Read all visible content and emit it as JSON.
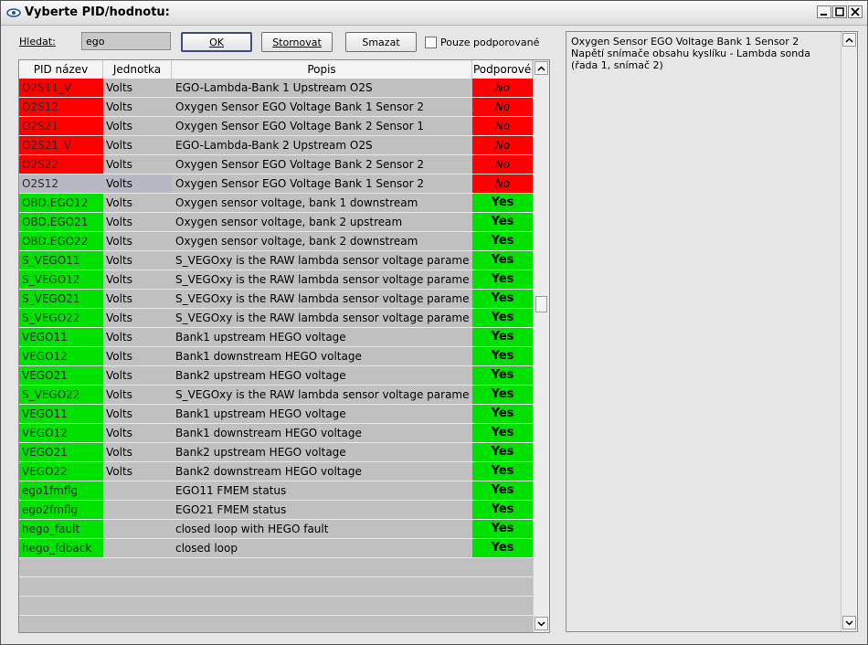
{
  "window": {
    "title": "Vyberte PID/hodnotu:",
    "icon": "eye-icon",
    "controls": [
      "minimize-icon",
      "maximize-icon",
      "close-icon"
    ]
  },
  "search": {
    "label": "Hledat:",
    "value": "ego"
  },
  "buttons": {
    "ok": "OK",
    "cancel": "Stornovat",
    "delete": "Smazat"
  },
  "filter": {
    "label": "Pouze podporované",
    "checked": false
  },
  "table": {
    "columns": [
      "PID název",
      "Jednotka",
      "Popis",
      "Podporové"
    ],
    "rows": [
      {
        "pid": "O2S11_V",
        "unit": "Volts",
        "desc": "EGO-Lambda-Bank 1 Upstream O2S",
        "sup": "No"
      },
      {
        "pid": "O2S12",
        "unit": "Volts",
        "desc": "Oxygen Sensor EGO Voltage Bank 1 Sensor 2",
        "sup": "No"
      },
      {
        "pid": "O2S21",
        "unit": "Volts",
        "desc": "Oxygen Sensor EGO Voltage Bank 2 Sensor 1",
        "sup": "No"
      },
      {
        "pid": "O2S21_V",
        "unit": "Volts",
        "desc": "EGO-Lambda-Bank 2 Upstream O2S",
        "sup": "No"
      },
      {
        "pid": "O2S22",
        "unit": "Volts",
        "desc": "Oxygen Sensor EGO Voltage Bank 2 Sensor 2",
        "sup": "No"
      },
      {
        "pid": "O2S12",
        "unit": "Volts",
        "desc": "Oxygen Sensor EGO Voltage Bank 1 Sensor 2",
        "sup": "No"
      },
      {
        "pid": "OBD.EGO12",
        "unit": "Volts",
        "desc": "Oxygen sensor voltage, bank 1 downstream",
        "sup": "Yes"
      },
      {
        "pid": "OBD.EGO21",
        "unit": "Volts",
        "desc": "Oxygen sensor voltage, bank 2 upstream",
        "sup": "Yes"
      },
      {
        "pid": "OBD.EGO22",
        "unit": "Volts",
        "desc": "Oxygen sensor voltage, bank 2 downstream",
        "sup": "Yes"
      },
      {
        "pid": "S_VEGO11",
        "unit": "Volts",
        "desc": "S_VEGOxy is the RAW lambda sensor voltage parame",
        "sup": "Yes"
      },
      {
        "pid": "S_VEGO12",
        "unit": "Volts",
        "desc": "S_VEGOxy is the RAW lambda sensor voltage parame",
        "sup": "Yes"
      },
      {
        "pid": "S_VEGO21",
        "unit": "Volts",
        "desc": "S_VEGOxy is the RAW lambda sensor voltage parame",
        "sup": "Yes"
      },
      {
        "pid": "S_VEGO22",
        "unit": "Volts",
        "desc": "S_VEGOxy is the RAW lambda sensor voltage parame",
        "sup": "Yes"
      },
      {
        "pid": "VEGO11",
        "unit": "Volts",
        "desc": "Bank1 upstream HEGO voltage",
        "sup": "Yes"
      },
      {
        "pid": "VEGO12",
        "unit": "Volts",
        "desc": "Bank1 downstream HEGO voltage",
        "sup": "Yes"
      },
      {
        "pid": "VEGO21",
        "unit": "Volts",
        "desc": "Bank2 upstream HEGO voltage",
        "sup": "Yes"
      },
      {
        "pid": "S_VEGO22",
        "unit": "Volts",
        "desc": "S_VEGOxy is the RAW lambda sensor voltage parame",
        "sup": "Yes"
      },
      {
        "pid": "VEGO11",
        "unit": "Volts",
        "desc": "Bank1 upstream HEGO voltage",
        "sup": "Yes"
      },
      {
        "pid": "VEGO12",
        "unit": "Volts",
        "desc": "Bank1 downstream HEGO voltage",
        "sup": "Yes"
      },
      {
        "pid": "VEGO21",
        "unit": "Volts",
        "desc": "Bank2 upstream HEGO voltage",
        "sup": "Yes"
      },
      {
        "pid": "VEGO22",
        "unit": "Volts",
        "desc": "Bank2 downstream HEGO voltage",
        "sup": "Yes"
      },
      {
        "pid": "ego1fmflg",
        "unit": "",
        "desc": "EGO11 FMEM status",
        "sup": "Yes"
      },
      {
        "pid": "ego2fmflg",
        "unit": "",
        "desc": "EGO21 FMEM status",
        "sup": "Yes"
      },
      {
        "pid": "hego_fault",
        "unit": "",
        "desc": "closed loop with HEGO fault",
        "sup": "Yes"
      },
      {
        "pid": "hego_fdback",
        "unit": "",
        "desc": "closed loop",
        "sup": "Yes"
      }
    ],
    "selected_index": 5
  },
  "detail": {
    "line1": "Oxygen Sensor EGO Voltage Bank 1 Sensor 2",
    "line2": "Napětí snímače obsahu kyslíku - Lambda sonda (řada 1, snímač 2)"
  },
  "colors": {
    "unsupported": "#ff0000",
    "supported": "#00e100",
    "selected": "#b8b8c4"
  }
}
